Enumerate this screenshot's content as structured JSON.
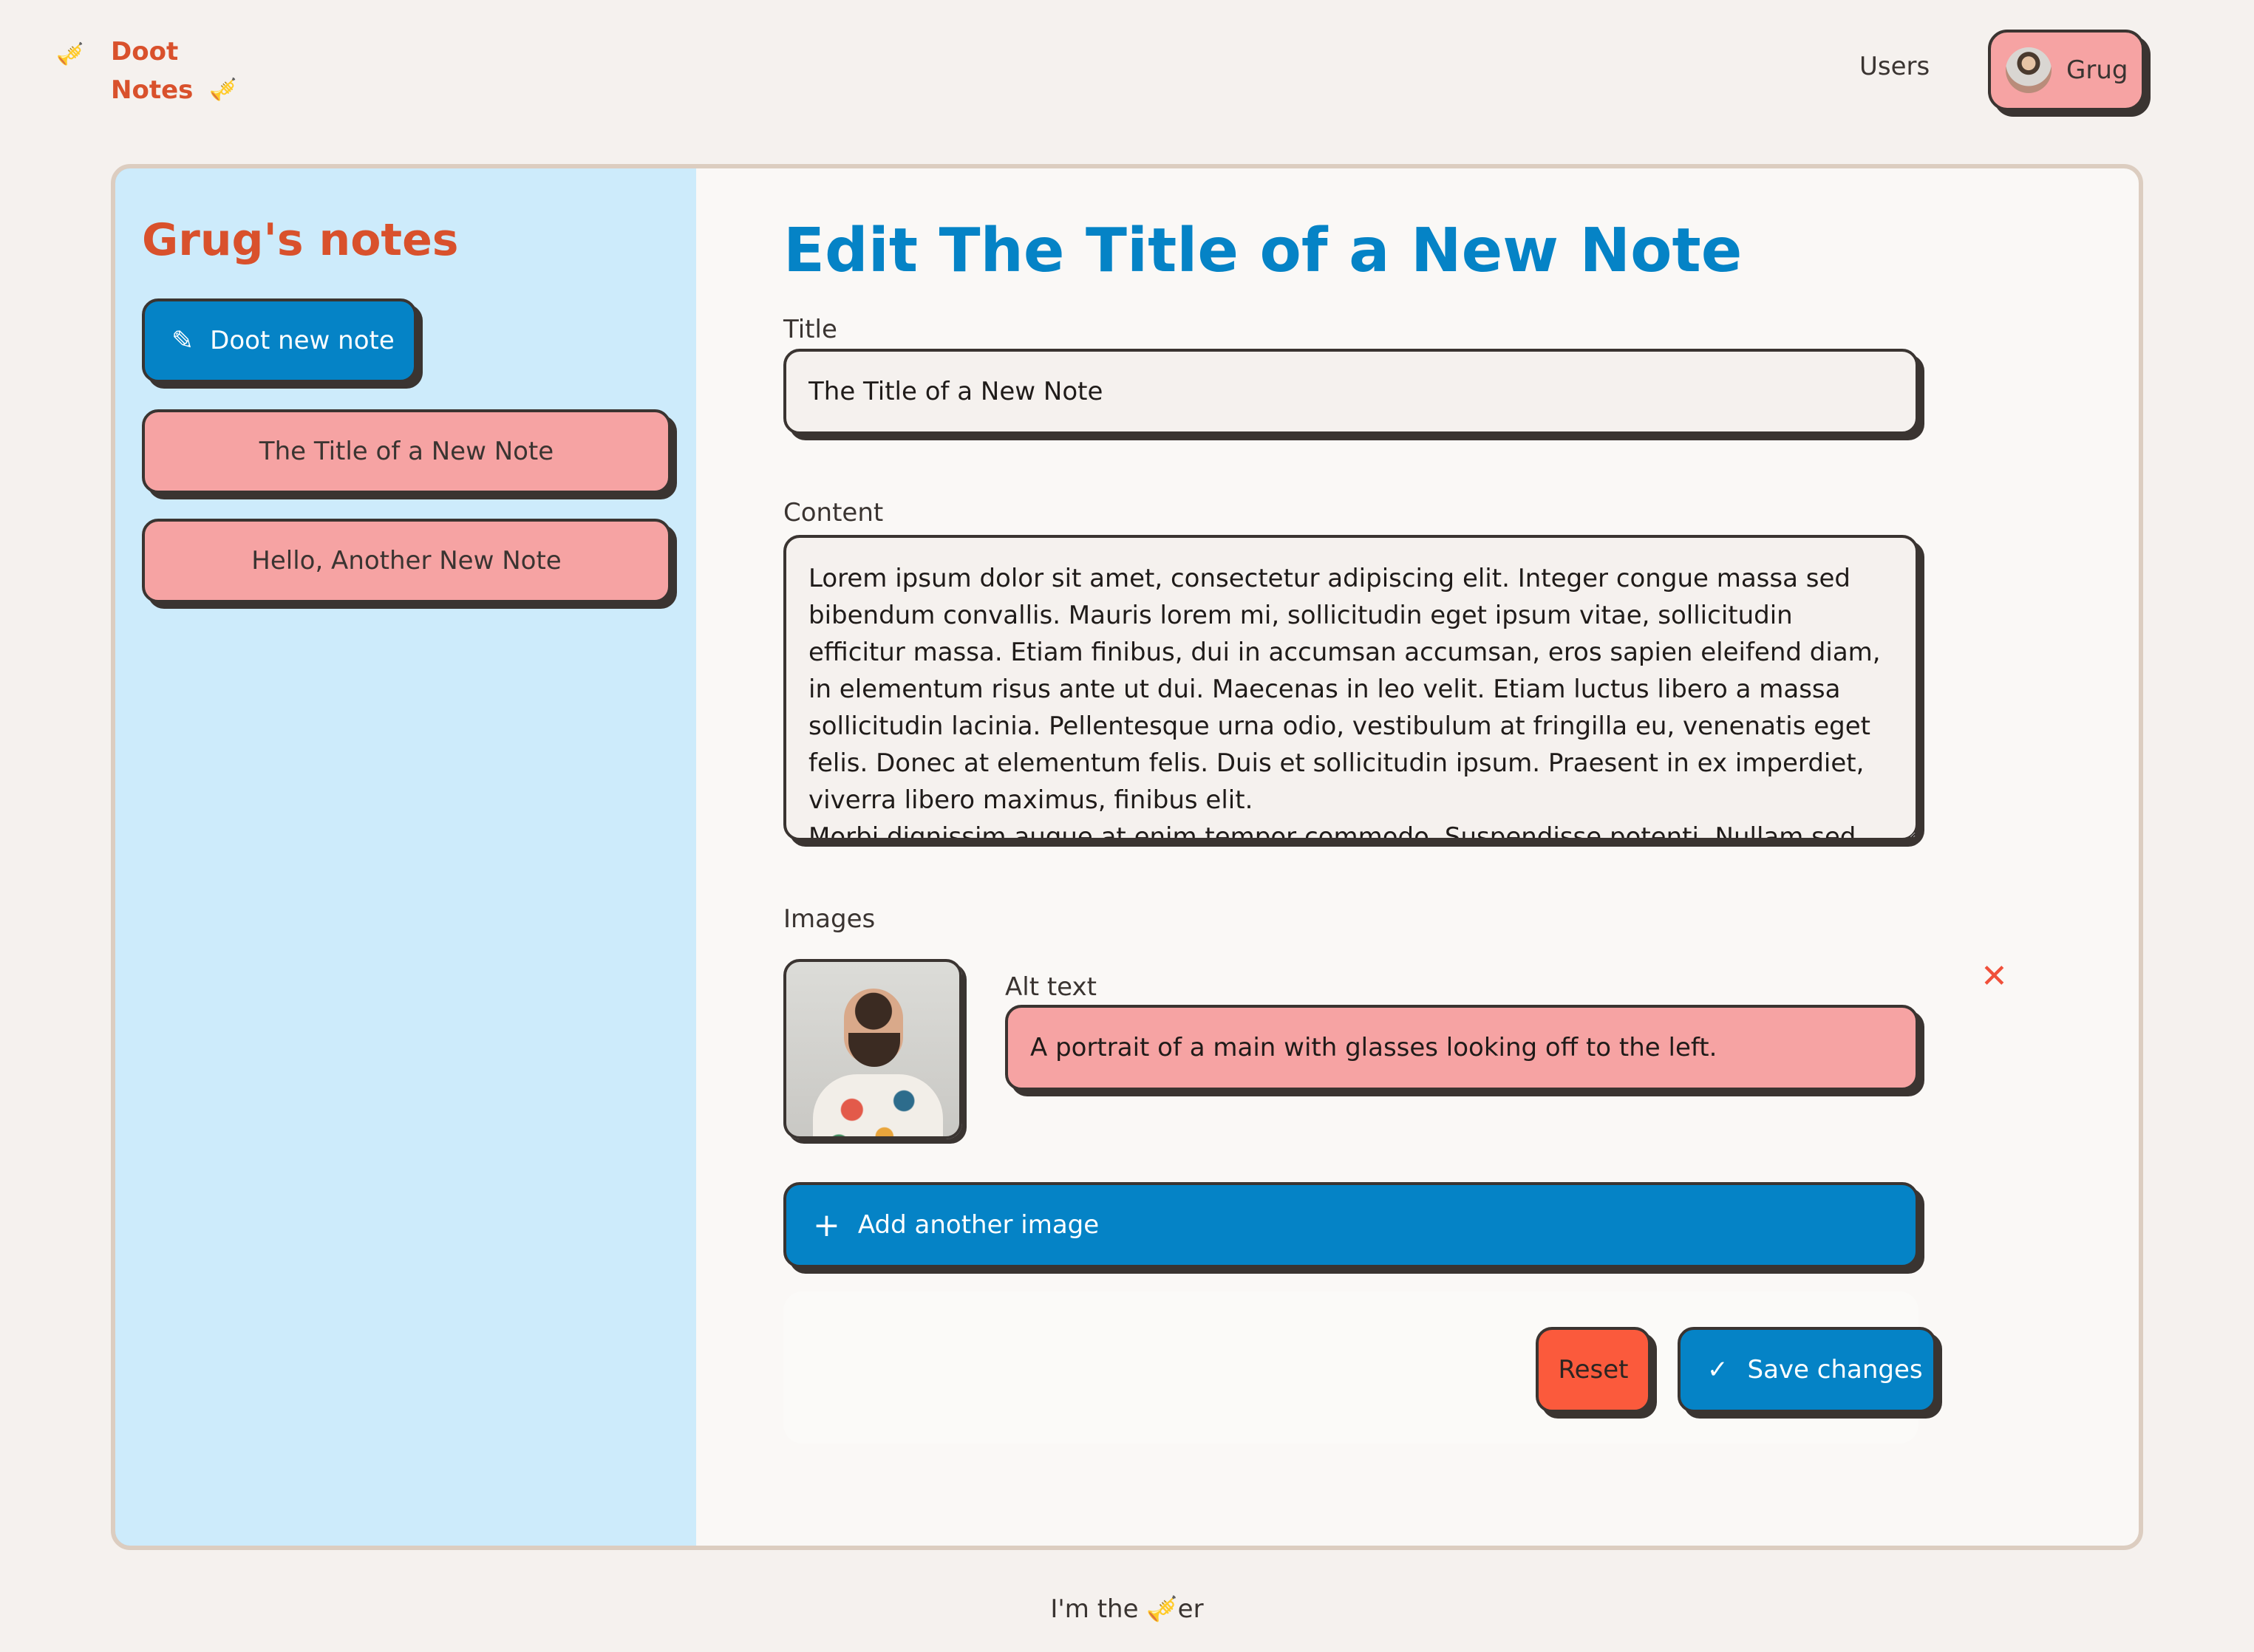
{
  "header": {
    "logo_line1": "Doot",
    "logo_line2": "Notes",
    "logo_icon": "🎺",
    "nav_users": "Users",
    "user_name": "Grug"
  },
  "sidebar": {
    "heading": "Grug's notes",
    "new_note_label": "Doot new note",
    "new_note_icon": "✎",
    "notes": [
      {
        "title": "The Title of a New Note"
      },
      {
        "title": "Hello, Another New Note"
      }
    ]
  },
  "editor": {
    "heading": "Edit The Title of a New Note",
    "title_label": "Title",
    "title_value": "The Title of a New Note",
    "content_label": "Content",
    "content_value": "Lorem ipsum dolor sit amet, consectetur adipiscing elit. Integer congue massa sed bibendum convallis. Mauris lorem mi, sollicitudin eget ipsum vitae, sollicitudin efficitur massa. Etiam finibus, dui in accumsan accumsan, eros sapien eleifend diam, in elementum risus ante ut dui. Maecenas in leo velit. Etiam luctus libero a massa sollicitudin lacinia. Pellentesque urna odio, vestibulum at fringilla eu, venenatis eget felis. Donec at elementum felis. Duis et sollicitudin ipsum. Praesent in ex imperdiet, viverra libero maximus, finibus elit.\nMorbi dignissim augue at enim tempor commodo. Suspendisse potenti. Nullam sed orci",
    "images_label": "Images",
    "alt_label": "Alt text",
    "alt_value": "A portrait of a main with glasses looking off to the left.",
    "remove_icon": "✕",
    "add_image_label": "Add another image",
    "add_image_icon": "+",
    "reset_label": "Reset",
    "save_label": "Save changes",
    "save_icon": "✓"
  },
  "footer": {
    "text_before": "I'm the ",
    "icon": "🎺",
    "text_after": "er"
  },
  "colors": {
    "page_bg": "#f5f1ee",
    "brand_orange": "#d9512c",
    "primary_blue": "#0583c6",
    "pink": "#f6a3a3",
    "danger": "#fb5a3c",
    "sidebar_bg": "#cdebfb",
    "sidebar_border": "#6ec2f2"
  }
}
